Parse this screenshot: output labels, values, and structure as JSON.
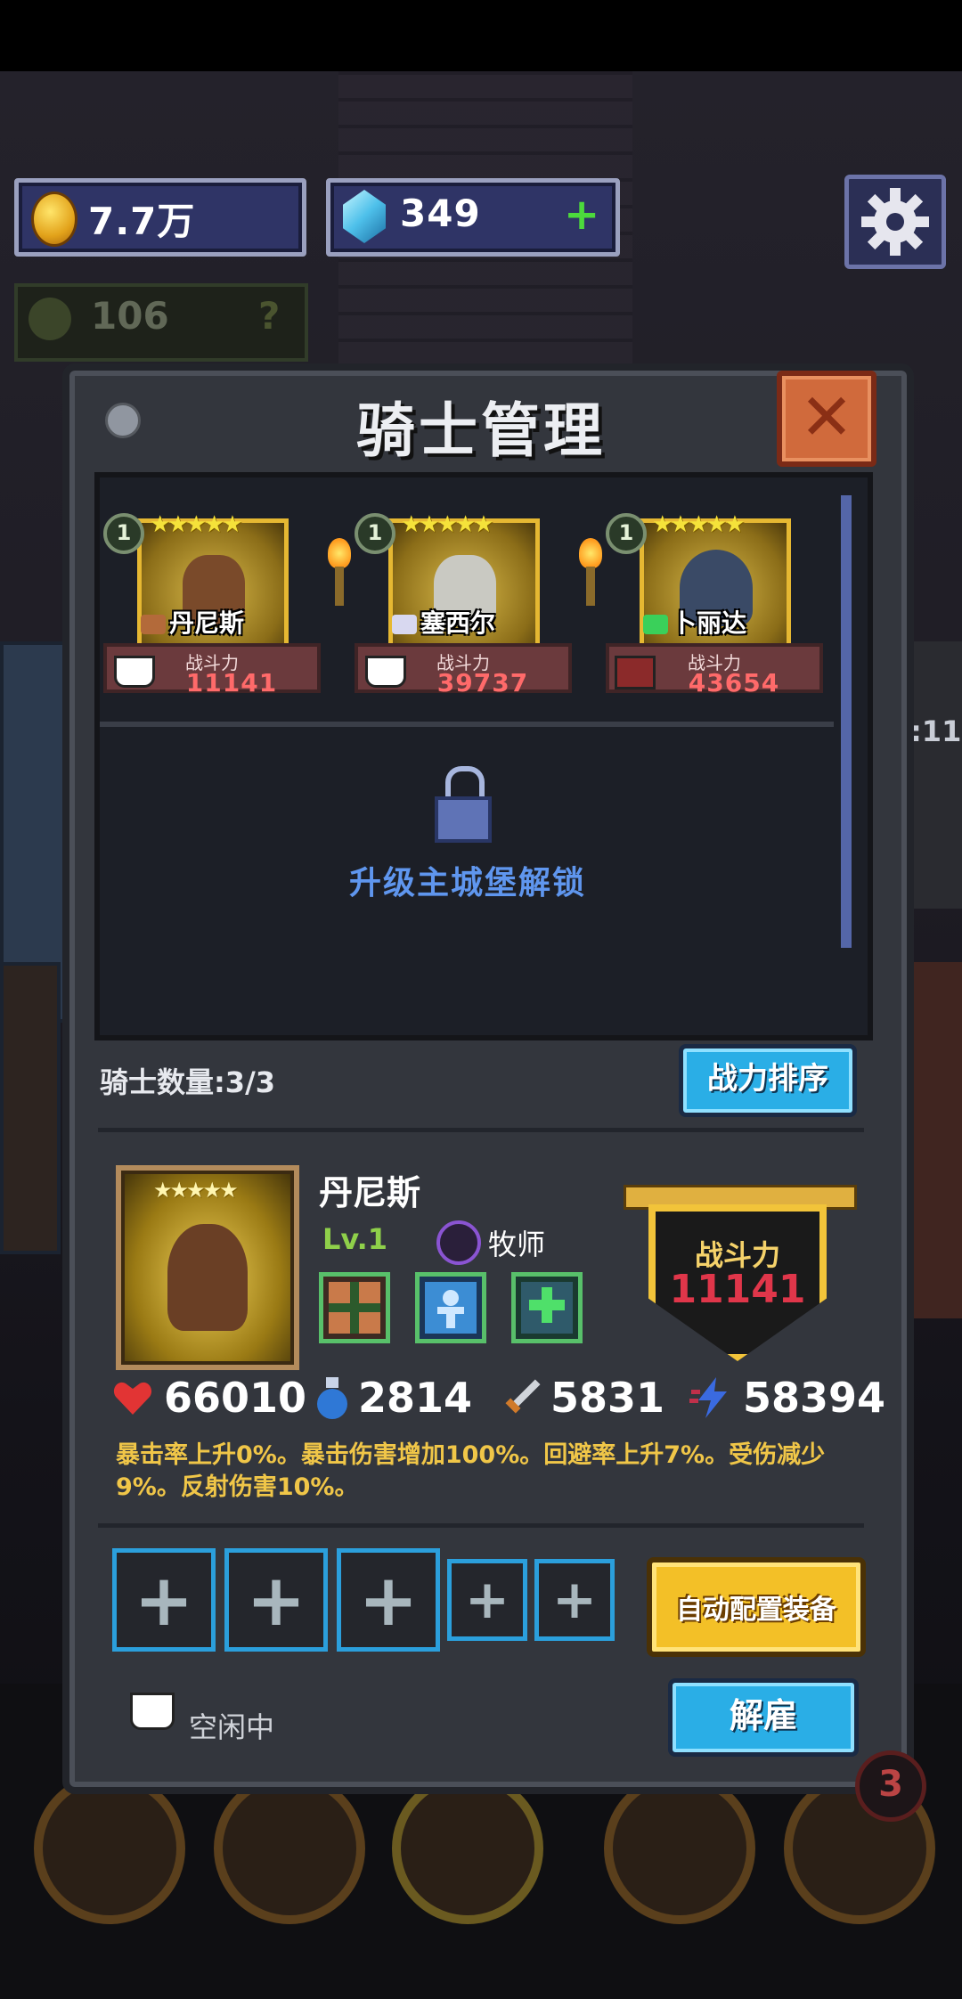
{
  "resources": {
    "gold": "7.7万",
    "gems": "349",
    "gems_add": "+",
    "trophy": "106",
    "trophy_help": "?"
  },
  "panel": {
    "title": "骑士管理",
    "close": "✕"
  },
  "knights": [
    {
      "level": "1",
      "stars": "★★★★★",
      "name": "丹尼斯",
      "power_label": "战斗力",
      "power": "11141"
    },
    {
      "level": "1",
      "stars": "★★★★★",
      "name": "塞西尔",
      "power_label": "战斗力",
      "power": "39737"
    },
    {
      "level": "1",
      "stars": "★★★★★",
      "name": "卜丽达",
      "power_label": "战斗力",
      "power": "43654"
    }
  ],
  "locked_slot": {
    "text": "升级主城堡解锁"
  },
  "roster": {
    "count_label": "骑士数量:3/3",
    "sort_button": "战力排序"
  },
  "detail": {
    "stars": "★★★★★",
    "name": "丹尼斯",
    "level": "Lv.1",
    "class": "牧师",
    "power_label": "战斗力",
    "power": "11141",
    "hp": "66010",
    "mp": "2814",
    "attack": "5831",
    "speed": "58394",
    "description": "暴击率上升0%。暴击伤害增加100%。回避率上升7%。受伤减少9%。反射伤害10%。"
  },
  "equipment": {
    "slots": [
      "+",
      "+",
      "+",
      "+",
      "+"
    ],
    "auto_button": "自动配置装备"
  },
  "status": {
    "text": "空闲中",
    "dismiss_button": "解雇"
  },
  "side": {
    "badge": "3",
    "clock": ":11"
  },
  "colors": {
    "power_red": "#ff6a6a",
    "accent_blue": "#2aaee6",
    "gold": "#f3c027"
  }
}
